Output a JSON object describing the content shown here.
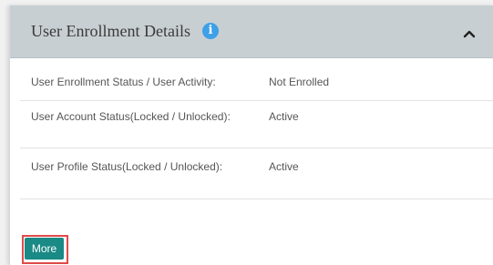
{
  "panel": {
    "title": "User Enrollment Details",
    "info_icon": "info-icon",
    "collapse_icon": "chevron-up-icon"
  },
  "details": {
    "rows": [
      {
        "label": "User Enrollment Status / User Activity:",
        "value": "Not Enrolled"
      },
      {
        "label": "User Account Status(Locked / Unlocked):",
        "value": "Active"
      },
      {
        "label": "User Profile Status(Locked / Unlocked):",
        "value": "Active"
      }
    ]
  },
  "actions": {
    "more_label": "More"
  },
  "colors": {
    "header_bg": "#c8cfd3",
    "info_icon": "#3ea0e6",
    "button_bg": "#1a8a86",
    "highlight": "#e04a4a"
  }
}
